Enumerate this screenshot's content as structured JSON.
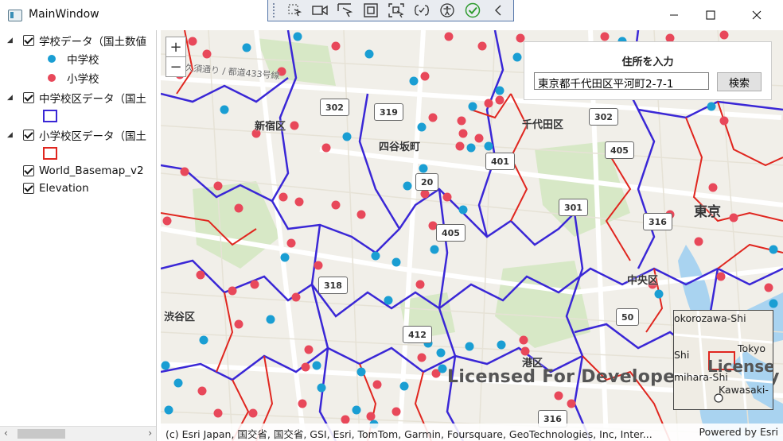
{
  "window": {
    "title": "MainWindow"
  },
  "debug_toolbar": {
    "icons": [
      "select-element-icon",
      "record-icon",
      "pointer-icon",
      "frame-icon",
      "track-focus-icon",
      "binding-icon",
      "accessibility-icon",
      "checkmark-icon",
      "collapse-icon"
    ]
  },
  "layers": {
    "items": [
      {
        "label": "学校データ（国土数値",
        "checked": true,
        "expanded": true
      },
      {
        "legend": "中学校",
        "color": "#1a9ed3"
      },
      {
        "legend": "小学校",
        "color": "#e8485a"
      },
      {
        "label": "中学校区データ（国土",
        "checked": true,
        "expanded": true,
        "box_color": "#3a27d6"
      },
      {
        "label": "小学校区データ（国土",
        "checked": true,
        "expanded": true,
        "box_color": "#e0261f"
      },
      {
        "label": "World_Basemap_v2",
        "checked": true
      },
      {
        "label": "Elevation",
        "checked": true
      }
    ]
  },
  "search": {
    "header": "住所を入力",
    "value": "東京都千代田区平河町2-7-1",
    "button": "検索"
  },
  "map": {
    "zoom_in": "+",
    "zoom_out": "−",
    "places": {
      "shinjuku": "新宿区",
      "yotsuya": "四谷坂町",
      "chiyoda": "千代田区",
      "tokyo": "東京",
      "chuo": "中央区",
      "shibuya": "渋谷区",
      "minato": "港区",
      "street1": "久須通り / 都道433号線"
    },
    "routes": [
      "302",
      "319",
      "302",
      "405",
      "20",
      "401",
      "301",
      "316",
      "405",
      "318",
      "412",
      "50",
      "316"
    ],
    "watermark": "Licensed For Developer Use Only",
    "attribution_left": "(c) Esri Japan, 国交省, 国交省, GSI, Esri, TomTom, Garmin, Foursquare, GeoTechnologies, Inc, Inter...",
    "attribution_right": "Powered by Esri",
    "overview": {
      "labels": [
        "okorozawa-Shi",
        "Tokyo",
        "Shi",
        "mihara-Shi",
        "Kawasaki-",
        "License"
      ]
    }
  },
  "colors": {
    "middle_school": "#1a9ed3",
    "elementary_school": "#e8485a",
    "middle_district": "#3a27d6",
    "elementary_district": "#e0261f"
  }
}
